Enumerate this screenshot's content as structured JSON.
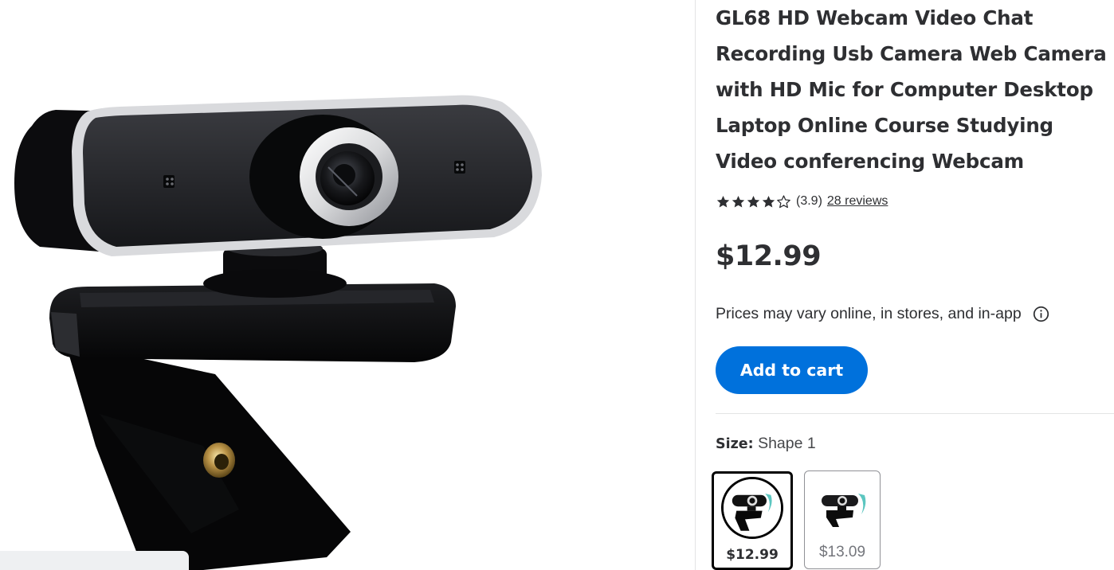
{
  "product": {
    "title": "GL68 HD Webcam Video Chat Recording Usb Camera Web Camera with HD Mic for Computer Desktop Laptop Online Course Studying Video conferencing Webcam",
    "rating": {
      "stars": 3.9,
      "max_stars": 5,
      "value_text": "(3.9)",
      "reviews_text": "28 reviews"
    },
    "price": "$12.99",
    "price_note": "Prices may vary online, in stores, and in-app",
    "add_to_cart_label": "Add to cart"
  },
  "size_selector": {
    "label": "Size:",
    "selected_value": "Shape 1",
    "options": [
      {
        "price": "$12.99",
        "selected": true
      },
      {
        "price": "$13.09",
        "selected": false
      }
    ]
  },
  "icons": {
    "info": "info-circle-icon",
    "star_full": "star-filled-icon",
    "star_empty": "star-outline-icon"
  },
  "colors": {
    "primary_button": "#0071dc",
    "text": "#2e2f32",
    "selected_border": "#000000",
    "unselected_border": "#909196"
  }
}
